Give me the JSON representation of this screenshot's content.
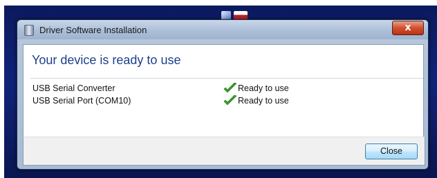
{
  "window": {
    "title": "Driver Software Installation",
    "close_glyph": "x"
  },
  "heading": "Your device is ready to use",
  "devices": [
    {
      "name": "USB Serial Converter",
      "status": "Ready to use",
      "status_icon": "check-icon"
    },
    {
      "name": "USB Serial Port (COM10)",
      "status": "Ready to use",
      "status_icon": "check-icon"
    }
  ],
  "buttons": {
    "close_label": "Close"
  },
  "colors": {
    "heading": "#1e3f8a",
    "check": "#3c9a2e",
    "close_accent": "#d1502f"
  }
}
